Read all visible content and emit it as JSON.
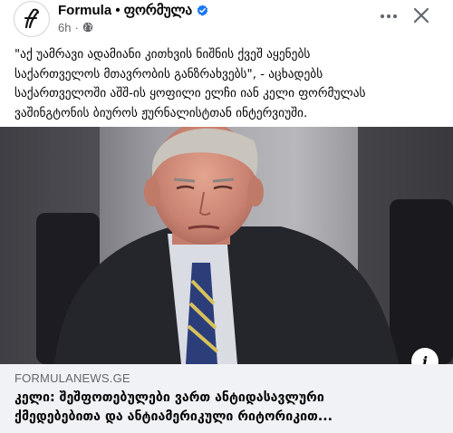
{
  "post": {
    "page_name": "Formula • ფორმულა",
    "time": "6h",
    "separator": "·",
    "avatar_icon": "formula-logo-icon",
    "verified_icon": "verified-badge-icon",
    "privacy_icon": "globe-icon",
    "more_icon": "more-horizontal-icon",
    "close_icon": "close-icon",
    "caption_lines": [
      "\"აქ უამრავი ადამიანი კითხვის ნიშნის ქვეშ აყენებს",
      "საქართველოს მთავრობის განზრახვებს\", - აცხადებს",
      "საქართველოში აშშ-ის ყოფილი ელჩი იან კელი ფორმულას",
      "ვაშინგტონის ბიუროს ჟურნალისტთან ინტერვიუში."
    ]
  },
  "image": {
    "info_icon": "info-icon",
    "info_label": "i"
  },
  "link_preview": {
    "domain": "FORMULANEWS.GE",
    "title_lines": [
      "კელი: შეშფოთებულები ვართ ანტიდასავლური",
      "ქმედებებითა და ანტიამერიკული რიტორიკით..."
    ]
  },
  "colors": {
    "verified": "#1877f2",
    "secondary_text": "#65676b",
    "preview_bg": "#f0f2f5"
  }
}
